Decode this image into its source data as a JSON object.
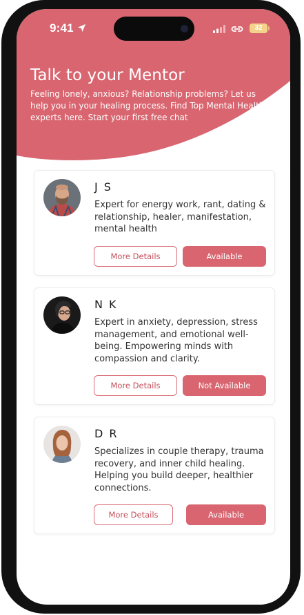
{
  "status_bar": {
    "time": "9:41",
    "battery": "32"
  },
  "header": {
    "title": "Talk to your Mentor",
    "subtitle": "Feeling lonely, anxious? Relationship problems? Let us help you in your healing process. Find Top Mental Health experts here. Start your first free chat"
  },
  "colors": {
    "accent": "#d8656f",
    "battery": "#f3d38a"
  },
  "mentors": [
    {
      "name": "J S",
      "description": "Expert for energy work, rant, dating & relationship, healer, manifestation, mental health",
      "details_label": "More Details",
      "status_label": "Available"
    },
    {
      "name": "N K",
      "description": "Expert in anxiety, depression, stress management, and emotional well-being. Empowering minds with compassion and clarity.",
      "details_label": "More Details",
      "status_label": "Not Available"
    },
    {
      "name": "D R",
      "description": "Specializes in couple therapy, trauma recovery, and inner child healing. Helping you build deeper, healthier connections.",
      "details_label": "More Details",
      "status_label": "Available"
    }
  ]
}
